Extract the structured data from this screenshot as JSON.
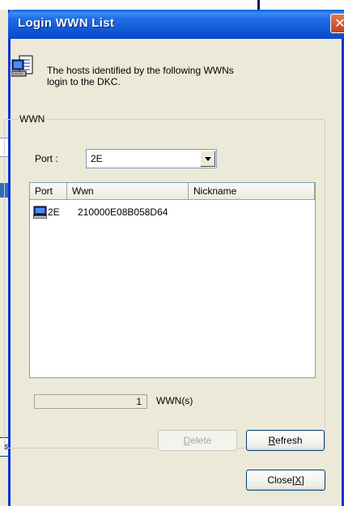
{
  "dialog": {
    "title": "Login WWN List",
    "close_glyph": "✕",
    "message_line1": "The hosts identified by the following WWNs",
    "message_line2": "login to the DKC."
  },
  "group": {
    "legend": "WWN",
    "port_label": "Port :",
    "port_value": "2E"
  },
  "list": {
    "columns": [
      "Port",
      "Wwn",
      "Nickname"
    ],
    "rows": [
      {
        "port": "2E",
        "wwn": "210000E08B058D64",
        "nickname": ""
      }
    ]
  },
  "count": {
    "value": "1",
    "label": "WWN(s)"
  },
  "buttons": {
    "delete_first": "D",
    "delete_rest": "elete",
    "refresh_first": "R",
    "refresh_rest": "efresh",
    "close_prefix": "Close[",
    "close_key": "X",
    "close_suffix": "]"
  },
  "background": {
    "partial_button_text": "s)"
  },
  "icons": {
    "info": "computer-document-icon",
    "host": "computer-monitor-icon",
    "dropdown": "chevron-down-icon",
    "close": "close-icon"
  },
  "colors": {
    "titlebar": "#0a5fd8",
    "frame": "#0831d9",
    "dialog_bg": "#ece9d8",
    "close": "#c4401e"
  }
}
